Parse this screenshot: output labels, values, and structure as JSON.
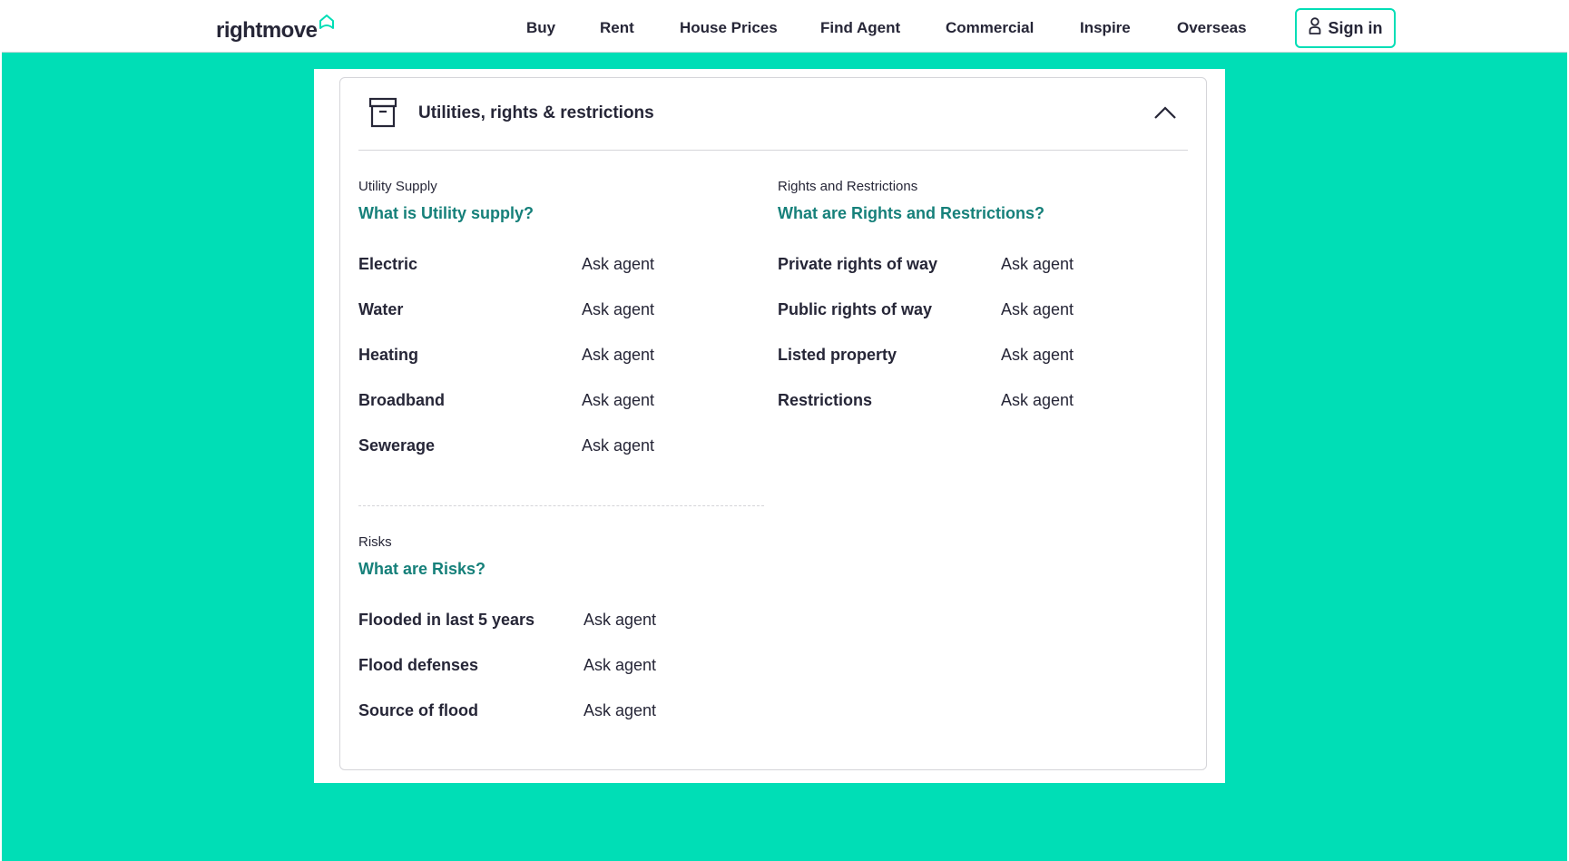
{
  "header": {
    "logo_text": "rightmove",
    "nav": [
      "Buy",
      "Rent",
      "House Prices",
      "Find Agent",
      "Commercial",
      "Inspire",
      "Overseas"
    ],
    "signin_label": "Sign in"
  },
  "colors": {
    "accent": "#00deb6",
    "link": "#16807a",
    "text": "#262637"
  },
  "card": {
    "title": "Utilities, rights & restrictions",
    "utility": {
      "label": "Utility Supply",
      "link": "What is Utility supply?",
      "rows": [
        {
          "key": "Electric",
          "value": "Ask agent"
        },
        {
          "key": "Water",
          "value": "Ask agent"
        },
        {
          "key": "Heating",
          "value": "Ask agent"
        },
        {
          "key": "Broadband",
          "value": "Ask agent"
        },
        {
          "key": "Sewerage",
          "value": "Ask agent"
        }
      ]
    },
    "rights": {
      "label": "Rights and Restrictions",
      "link": "What are Rights and Restrictions?",
      "rows": [
        {
          "key": "Private rights of way",
          "value": "Ask agent"
        },
        {
          "key": "Public rights of way",
          "value": "Ask agent"
        },
        {
          "key": "Listed property",
          "value": "Ask agent"
        },
        {
          "key": "Restrictions",
          "value": "Ask agent"
        }
      ]
    },
    "risks": {
      "label": "Risks",
      "link": "What are Risks?",
      "rows": [
        {
          "key": "Flooded in last 5 years",
          "value": "Ask agent"
        },
        {
          "key": "Flood defenses",
          "value": "Ask agent"
        },
        {
          "key": "Source of flood",
          "value": "Ask agent"
        }
      ]
    }
  }
}
